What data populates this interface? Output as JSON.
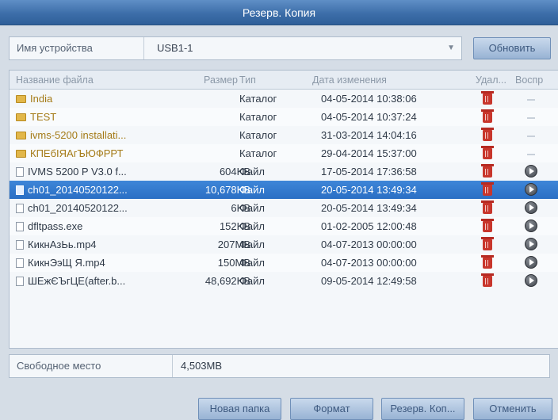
{
  "window": {
    "title": "Резерв. Копия"
  },
  "device": {
    "label": "Имя устройства",
    "value": "USB1-1",
    "refresh_label": "Обновить"
  },
  "columns": {
    "name": "Название файла",
    "size": "Размер",
    "type": "Тип",
    "date": "Дата изменения",
    "delete": "Удал...",
    "play": "Воспр"
  },
  "rows": [
    {
      "name": "India",
      "size": "",
      "type": "Каталог",
      "date": "04-05-2014 10:38:06",
      "kind": "folder"
    },
    {
      "name": "TEST",
      "size": "",
      "type": "Каталог",
      "date": "04-05-2014 10:37:24",
      "kind": "folder"
    },
    {
      "name": "ivms-5200 installati...",
      "size": "",
      "type": "Каталог",
      "date": "31-03-2014 14:04:16",
      "kind": "folder"
    },
    {
      "name": "КПЕбІЯАгЪЮФРРТ",
      "size": "",
      "type": "Каталог",
      "date": "29-04-2014 15:37:00",
      "kind": "folder"
    },
    {
      "name": "IVMS 5200 P V3.0 f...",
      "size": "604KB",
      "type": "Файл",
      "date": "17-05-2014 17:36:58",
      "kind": "file"
    },
    {
      "name": "ch01_20140520122...",
      "size": "10,678KB",
      "type": "Файл",
      "date": "20-05-2014 13:49:34",
      "kind": "file",
      "selected": true
    },
    {
      "name": "ch01_20140520122...",
      "size": "6KB",
      "type": "Файл",
      "date": "20-05-2014 13:49:34",
      "kind": "file"
    },
    {
      "name": "dfltpass.exe",
      "size": "152KB",
      "type": "Файл",
      "date": "01-02-2005 12:00:48",
      "kind": "file"
    },
    {
      "name": "КикнАзЬь.mp4",
      "size": "207MB",
      "type": "Файл",
      "date": "04-07-2013 00:00:00",
      "kind": "file"
    },
    {
      "name": "КикнЭэЩ Я.mp4",
      "size": "150MB",
      "type": "Файл",
      "date": "04-07-2013 00:00:00",
      "kind": "file"
    },
    {
      "name": "ШЕжЄЪгЦЕ(after.b...",
      "size": "48,692KB",
      "type": "Файл",
      "date": "09-05-2014 12:49:58",
      "kind": "file"
    }
  ],
  "free_space": {
    "label": "Свободное место",
    "value": "4,503MB"
  },
  "buttons": {
    "new_folder": "Новая папка",
    "format": "Формат",
    "backup": "Резерв. Коп...",
    "cancel": "Отменить"
  },
  "colors": {
    "titlebar": "#3d6ea9",
    "selected_row": "#2a6fc4",
    "folder_text": "#a47a16",
    "trash": "#c8362c"
  }
}
